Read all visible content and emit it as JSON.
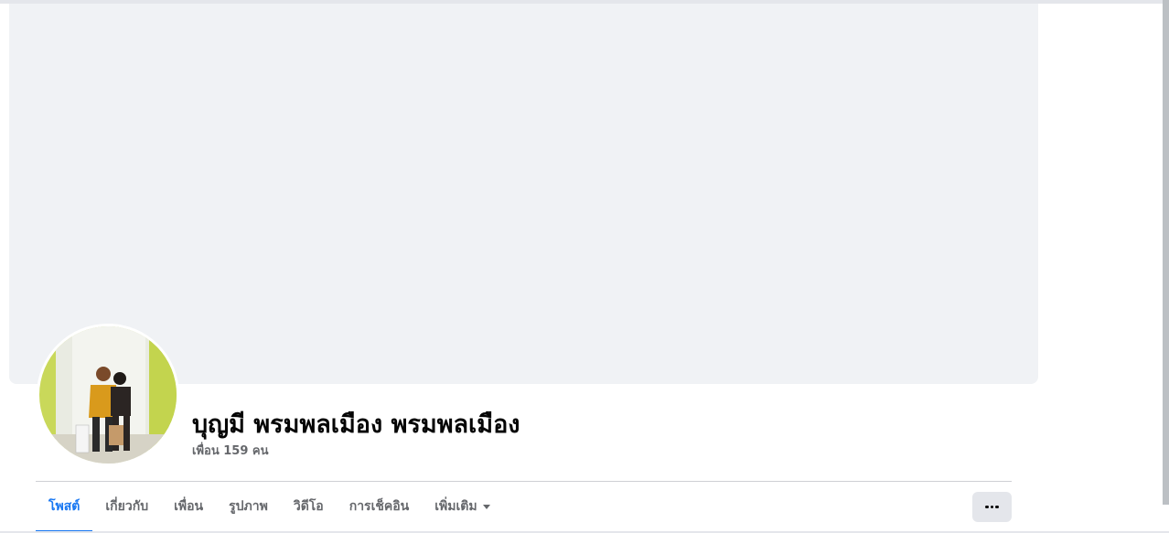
{
  "profile": {
    "name": "บุญมี พรมพลเมือง พรมพลเมือง",
    "friends_count": "เพื่อน 159 คน"
  },
  "tabs": [
    {
      "label": "โพสต์",
      "active": true
    },
    {
      "label": "เกี่ยวกับ"
    },
    {
      "label": "เพื่อน"
    },
    {
      "label": "รูปภาพ"
    },
    {
      "label": "วิดีโอ"
    },
    {
      "label": "การเช็คอิน"
    },
    {
      "label": "เพิ่มเติม",
      "has_dropdown": true
    }
  ],
  "icons": {
    "more_menu": "more-horizontal-icon",
    "dropdown": "caret-down-icon"
  },
  "colors": {
    "accent": "#1877f2",
    "cover_placeholder": "#f0f2f5",
    "secondary_text": "#65676b",
    "primary_text": "#050505",
    "button_bg": "#e4e6eb"
  }
}
